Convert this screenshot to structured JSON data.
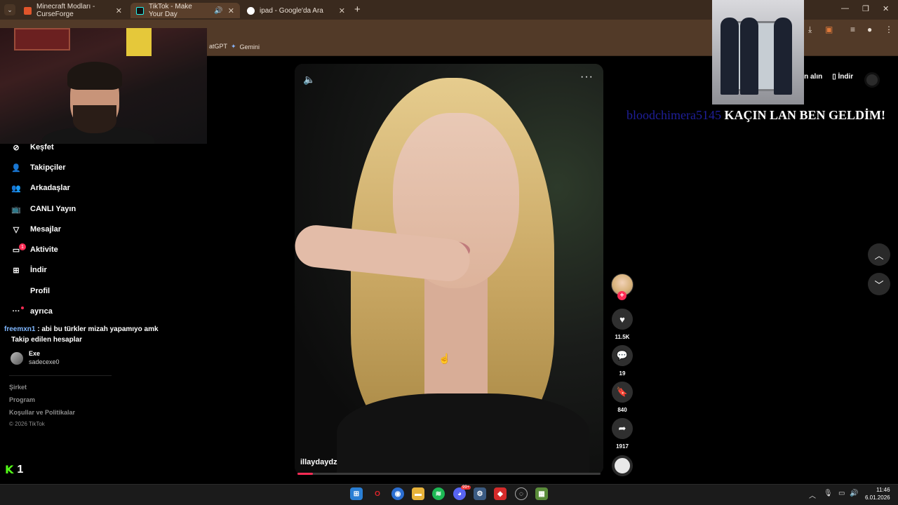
{
  "browser": {
    "tabs": [
      {
        "title": "Minecraft Modları - CurseForge",
        "active": false
      },
      {
        "title": "TikTok - Make Your Day",
        "active": true
      },
      {
        "title": "ipad - Google'da Ara",
        "active": false
      }
    ],
    "bookmarks": [
      {
        "label": "atGPT"
      },
      {
        "label": "Gemini"
      }
    ]
  },
  "header": {
    "get_coins": "on alın",
    "download": "İndir"
  },
  "overlays": {
    "chat_big": {
      "user": "bloodchimera5145",
      "message": "KAÇIN LAN BEN GELDİM!"
    },
    "chat_small": {
      "user": "freemxn1",
      "message": " : abi bu türkler mizah yapamıyo amk"
    },
    "kick_viewers": "1"
  },
  "sidebar": {
    "nav": [
      {
        "label": "Keşfet",
        "icon": "compass-icon"
      },
      {
        "label": "Takipçiler",
        "icon": "user-plus-icon"
      },
      {
        "label": "Arkadaşlar",
        "icon": "friends-icon"
      },
      {
        "label": "CANLI Yayın",
        "icon": "live-tv-icon"
      },
      {
        "label": "Mesajlar",
        "icon": "send-icon"
      },
      {
        "label": "Aktivite",
        "icon": "activity-icon",
        "badge": "1"
      },
      {
        "label": "İndir",
        "icon": "download-plus-icon"
      },
      {
        "label": "Profil",
        "icon": ""
      },
      {
        "label": "ayrıca",
        "icon": "more-dots-icon"
      }
    ],
    "following_title": "Takip edilen hesaplar",
    "account": {
      "name": "Exe",
      "handle": "sadecexe0"
    },
    "footer": [
      "Şirket",
      "Program",
      "Koşullar ve Politikalar"
    ],
    "copyright": "© 2026 TikTok"
  },
  "video": {
    "username": "illaydaydz",
    "progress": 0.05
  },
  "actions": {
    "likes": "11.5K",
    "comments": "19",
    "saves": "840",
    "shares": "1917"
  },
  "taskbar": {
    "time": "11:46",
    "date": "6.01.2026",
    "discord_badge": "99+"
  }
}
